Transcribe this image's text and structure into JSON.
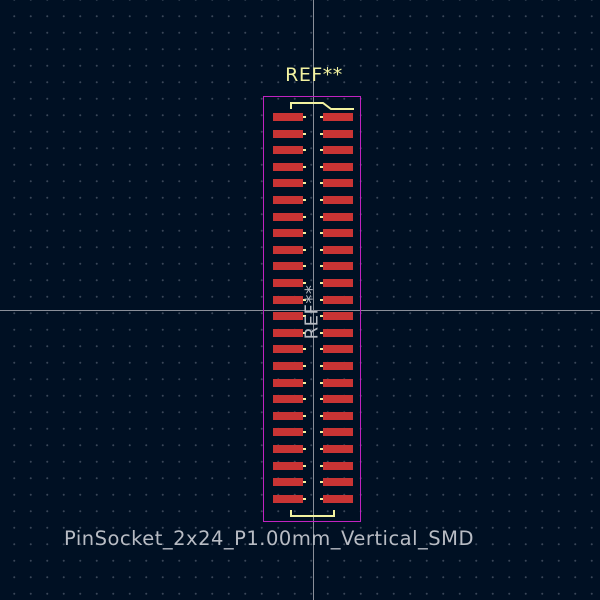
{
  "canvas": {
    "background_color": "#001023",
    "grid_color": "#3a4658",
    "crosshair_color": "#8a8f99"
  },
  "footprint": {
    "reference_top": "REF**",
    "reference_fab": "REF**",
    "name": "PinSocket_2x24_P1.00mm_Vertical_SMD",
    "pin_rows": 24,
    "pin_columns": 2,
    "pad_color": "#c93434",
    "silkscreen_color": "#f2f2a0",
    "courtyard_color": "#c023c0",
    "fab_text_color": "#b8bcc4"
  }
}
